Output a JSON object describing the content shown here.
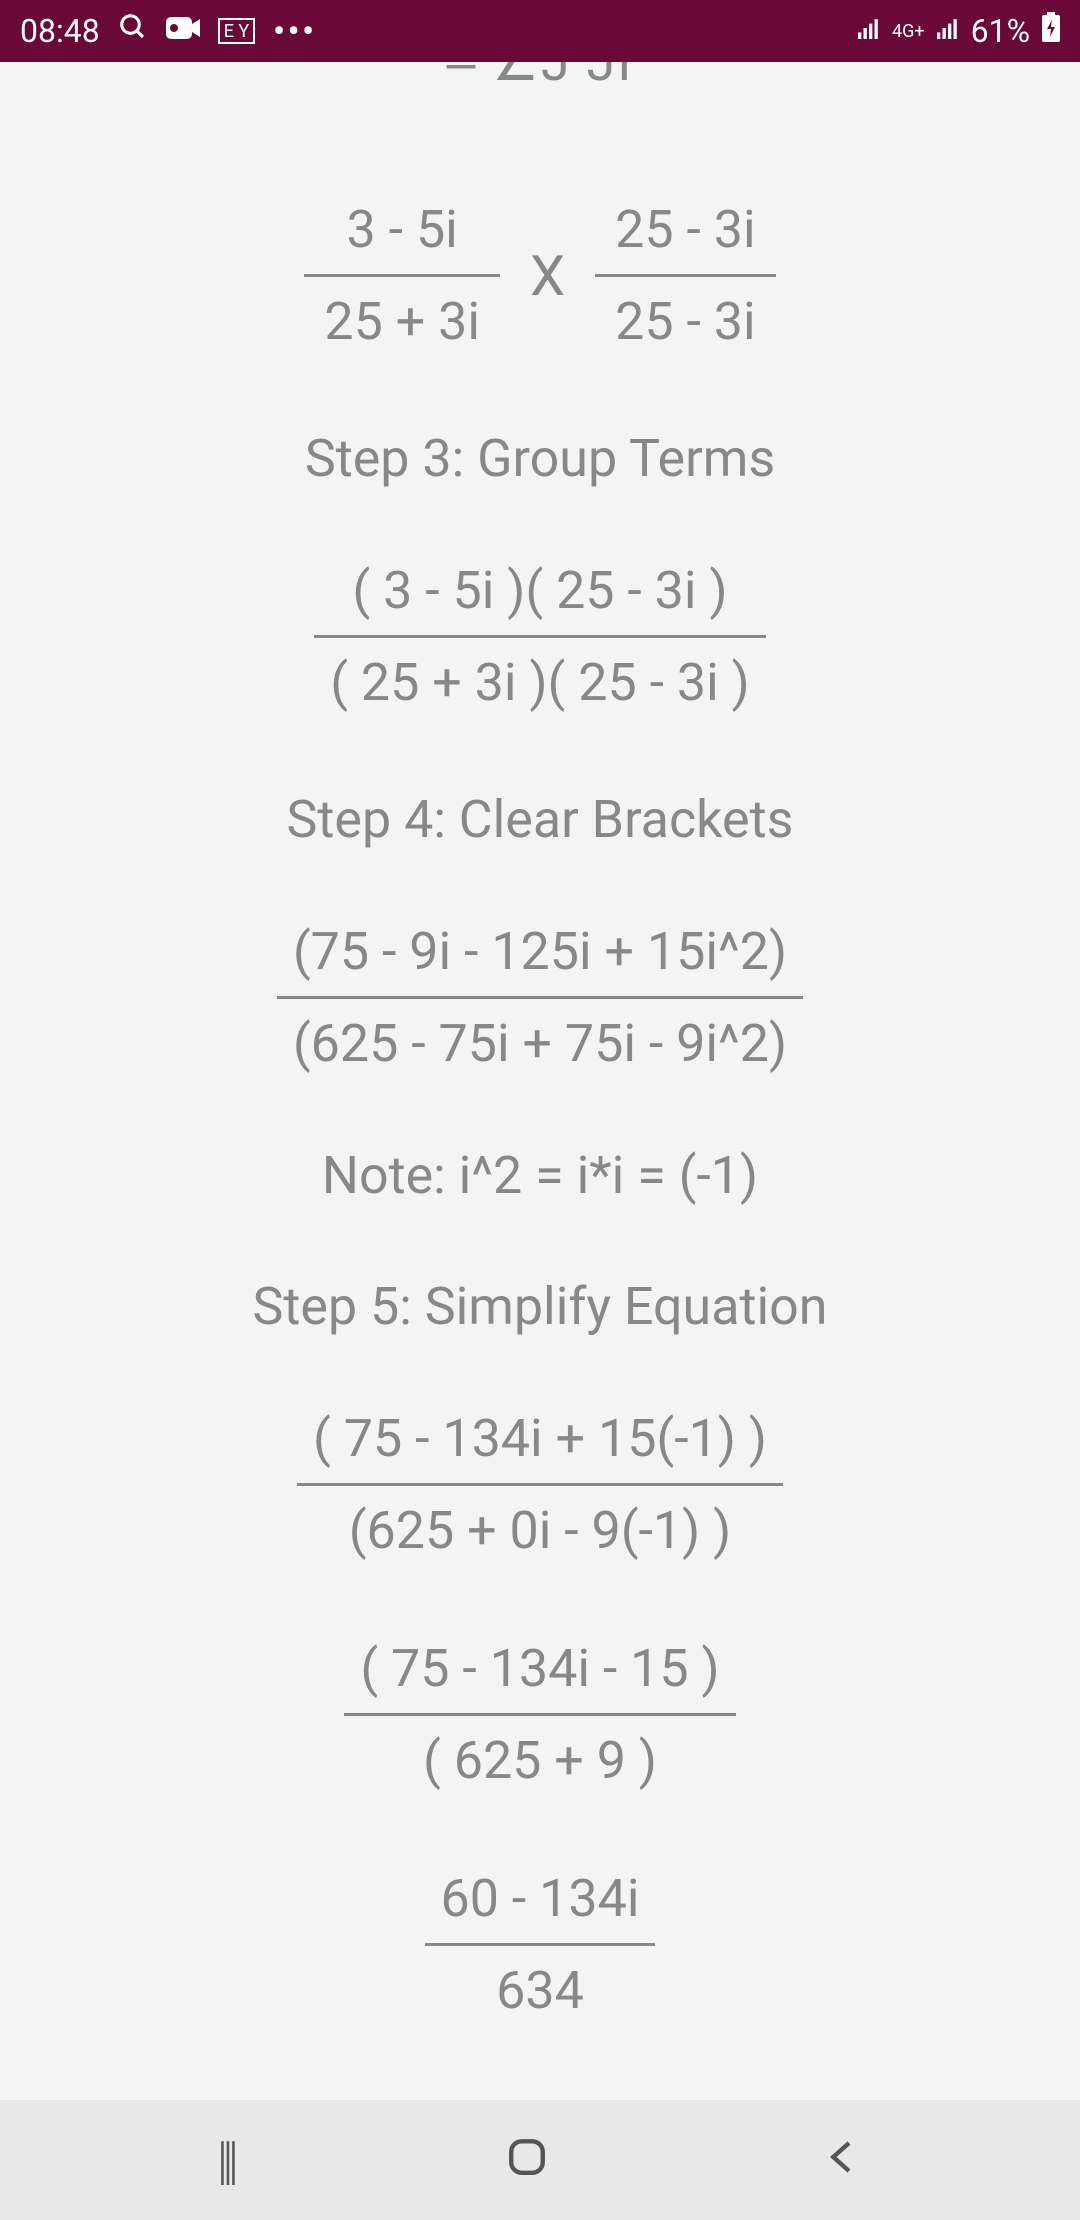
{
  "status": {
    "time": "08:48",
    "network_type": "4G+",
    "battery": "61%"
  },
  "content": {
    "partial_top": "‒ ∠J     JI",
    "frac1": {
      "num": "3 - 5i",
      "den": "25 + 3i"
    },
    "mult": "X",
    "frac2": {
      "num": "25 - 3i",
      "den": "25 - 3i"
    },
    "step3_title": "Step 3: Group Terms",
    "step3_frac": {
      "num": "( 3 - 5i )( 25 - 3i )",
      "den": "( 25 + 3i )( 25 - 3i )"
    },
    "step4_title": "Step 4: Clear Brackets",
    "step4_frac": {
      "num": "(75 - 9i - 125i + 15i^2)",
      "den": "(625 - 75i + 75i - 9i^2)"
    },
    "note": "Note: i^2 = i*i = (-1)",
    "step5_title": "Step 5: Simplify Equation",
    "step5a_frac": {
      "num": "( 75 - 134i + 15(-1) )",
      "den": "(625 + 0i - 9(-1) )"
    },
    "step5b_frac": {
      "num": "( 75 - 134i - 15 )",
      "den": "( 625 + 9 )"
    },
    "step5c_frac": {
      "num": "60 - 134i",
      "den": "634"
    }
  }
}
